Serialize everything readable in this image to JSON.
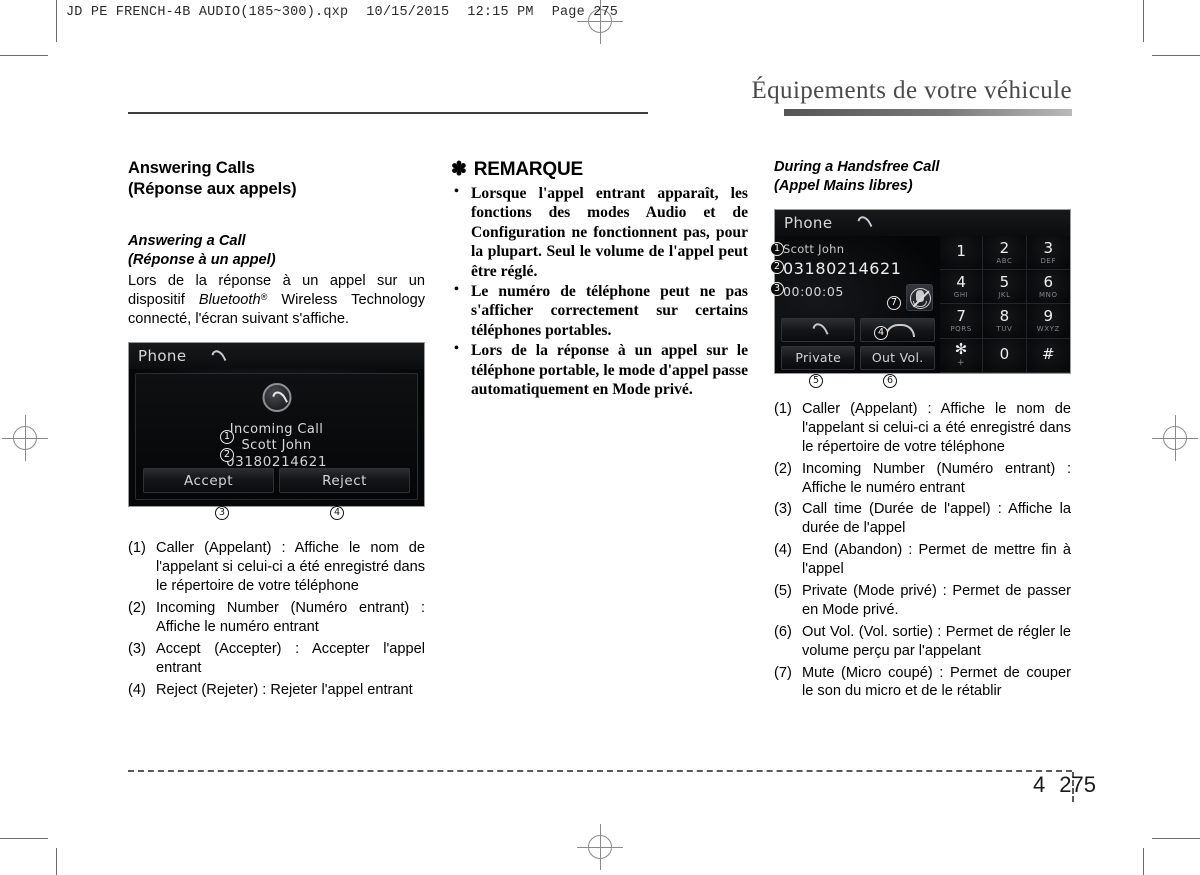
{
  "file_header": {
    "filename": "JD PE FRENCH-4B AUDIO(185~300).qxp",
    "date": "10/15/2015",
    "time": "12:15 PM",
    "page_label": "Page 275"
  },
  "chapter": {
    "title": "Équipements de votre véhicule"
  },
  "footer": {
    "chapter_number": "4",
    "page_number": "275"
  },
  "col1": {
    "heading_line1": "Answering Calls",
    "heading_line2": "(Réponse aux appels)",
    "sub_line1": "Answering a Call",
    "sub_line2": "(Réponse à un appel)",
    "paragraph_a": "Lors de la réponse à un appel sur un dispositif ",
    "paragraph_bt": "Bluetooth",
    "paragraph_bt_sup": "®",
    "paragraph_b": " Wireless Technology connecté, l'écran suivant s'affiche.",
    "screenshot": {
      "title": "Phone",
      "title_icon": "handset-icon",
      "center_icon": "incoming-call-icon",
      "line_incoming": "Incoming Call",
      "line_name": "Scott John",
      "line_number": "03180214621",
      "accept_label": "Accept",
      "reject_label": "Reject",
      "callouts": {
        "name": "1",
        "number": "2",
        "accept": "3",
        "reject": "4"
      }
    },
    "defs": [
      {
        "num": "(1)",
        "text": "Caller (Appelant) : Affiche le nom de l'appelant si celui-ci a été enregistré dans le répertoire de votre téléphone"
      },
      {
        "num": "(2)",
        "text": "Incoming Number (Numéro entrant) : Affiche le numéro entrant"
      },
      {
        "num": "(3)",
        "text": "Accept (Accepter) : Accepter l'appel entrant"
      },
      {
        "num": "(4)",
        "text": "Reject (Rejeter) : Rejeter l'appel entrant"
      }
    ]
  },
  "col2": {
    "note_asterisk": "✽",
    "note_title": "REMARQUE",
    "note_items": [
      "Lorsque l'appel entrant apparaît, les fonctions des modes Audio et de Configuration ne fonctionnent pas, pour la plupart. Seul le volume de l'appel peut être réglé.",
      "Le numéro de téléphone peut ne pas s'afficher correctement sur certains téléphones portables.",
      "Lors de la réponse à un appel sur le téléphone portable, le mode d'appel passe automatiquement en Mode privé."
    ]
  },
  "col3": {
    "sub_line1": "During a Handsfree Call",
    "sub_line2": "(Appel Mains libres)",
    "screenshot": {
      "title": "Phone",
      "title_icon": "handset-icon",
      "caller_name": "Scott John",
      "caller_number": "03180214621",
      "call_time": "00:00:05",
      "mute_icon": "mute-mic-icon",
      "call_icon": "handset-icon",
      "end_icon": "end-call-icon",
      "private_label": "Private",
      "outvol_label": "Out Vol.",
      "keys": [
        {
          "digit": "1",
          "sub": ""
        },
        {
          "digit": "2",
          "sub": "ABC"
        },
        {
          "digit": "3",
          "sub": "DEF"
        },
        {
          "digit": "4",
          "sub": "GHI"
        },
        {
          "digit": "5",
          "sub": "JKL"
        },
        {
          "digit": "6",
          "sub": "MNO"
        },
        {
          "digit": "7",
          "sub": "PQRS"
        },
        {
          "digit": "8",
          "sub": "TUV"
        },
        {
          "digit": "9",
          "sub": "WXYZ"
        },
        {
          "digit": "✻",
          "sub": "+"
        },
        {
          "digit": "0",
          "sub": ""
        },
        {
          "digit": "#",
          "sub": ""
        }
      ],
      "callouts": {
        "name": "1",
        "number": "2",
        "time": "3",
        "end": "4",
        "private": "5",
        "outvol": "6",
        "mute": "7"
      }
    },
    "defs": [
      {
        "num": "(1)",
        "text": "Caller (Appelant) : Affiche le nom de l'appelant si celui-ci a été enregistré dans le répertoire de votre téléphone"
      },
      {
        "num": "(2)",
        "text": "Incoming Number (Numéro entrant) : Affiche le numéro entrant"
      },
      {
        "num": "(3)",
        "text": "Call time (Durée de l'appel) : Affiche la durée de l'appel"
      },
      {
        "num": "(4)",
        "text": "End (Abandon) : Permet de mettre fin à l'appel"
      },
      {
        "num": "(5)",
        "text": "Private (Mode privé) : Permet de passer en Mode privé."
      },
      {
        "num": "(6)",
        "text": "Out Vol. (Vol. sortie) : Permet de régler le volume perçu par l'appelant"
      },
      {
        "num": "(7)",
        "text": "Mute (Micro coupé) : Permet de couper le son du micro et de le rétablir"
      }
    ]
  }
}
